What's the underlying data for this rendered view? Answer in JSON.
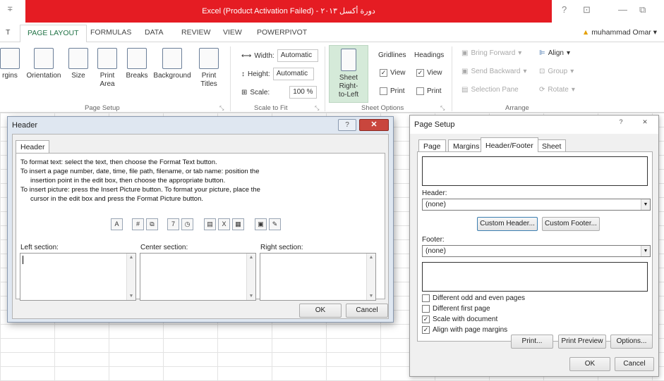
{
  "window": {
    "title": "Excel (Product Activation Failed) - دورة أكسل ٢٠١٣",
    "quick_access": "∓",
    "controls": [
      "?",
      "⊡",
      "—",
      "⧉"
    ]
  },
  "tabs": [
    {
      "label": "T"
    },
    {
      "label": "PAGE LAYOUT",
      "active": true
    },
    {
      "label": "FORMULAS"
    },
    {
      "label": "DATA"
    },
    {
      "label": "REVIEW"
    },
    {
      "label": "VIEW"
    },
    {
      "label": "POWERPIVOT"
    }
  ],
  "user": {
    "name": "muhammad Omar",
    "chevron": "▾"
  },
  "ribbon": {
    "page_setup": {
      "margins": "rgins",
      "orientation": "Orientation",
      "size": "Size",
      "print_area": "Print",
      "print_area_2": "Area",
      "breaks": "Breaks",
      "background": "Background",
      "print_titles": "Print",
      "print_titles_2": "Titles",
      "group": "Page Setup"
    },
    "scale_to_fit": {
      "width_label": "Width:",
      "width_value": "Automatic",
      "height_label": "Height:",
      "height_value": "Automatic",
      "scale_label": "Scale:",
      "scale_value": "100 %",
      "group": "Scale to Fit"
    },
    "sheet_options": {
      "sheet_rtl": "Sheet Right-",
      "sheet_rtl_2": "to-Left",
      "gridlines": "Gridlines",
      "headings": "Headings",
      "view": "View",
      "print": "Print",
      "group": "Sheet Options"
    },
    "arrange": {
      "bring_forward": "Bring Forward",
      "send_backward": "Send Backward",
      "selection_pane": "Selection Pane",
      "align": "Align",
      "group_btn": "Group",
      "rotate": "Rotate",
      "group": "Arrange"
    },
    "dialog_launcher": "⤡"
  },
  "header_dialog": {
    "title": "Header",
    "help": "?",
    "close": "✕",
    "tab": "Header",
    "instructions": [
      "To format text:  select the text, then choose the Format Text button.",
      "To insert a page number, date, time, file path, filename, or tab name:  position the",
      "insertion point in the edit box, then choose the appropriate button.",
      "To insert picture: press the Insert Picture button.  To format your picture, place the",
      "cursor in the edit box and press the Format Picture button."
    ],
    "toolbar": [
      "A",
      "#",
      "⧉",
      "7",
      "◷",
      "▤",
      "X",
      "▦",
      "▣",
      "✎"
    ],
    "left_section": "Left section:",
    "center_section": "Center section:",
    "right_section": "Right section:",
    "ok": "OK",
    "cancel": "Cancel"
  },
  "page_setup": {
    "title": "Page Setup",
    "help": "?",
    "close": "✕",
    "tabs": [
      "Page",
      "Margins",
      "Header/Footer",
      "Sheet"
    ],
    "active_tab": "Header/Footer",
    "header_label": "Header:",
    "header_value": "(none)",
    "custom_header": "Custom Header...",
    "custom_footer": "Custom Footer...",
    "footer_label": "Footer:",
    "footer_value": "(none)",
    "checks": [
      {
        "label": "Different odd and even pages",
        "checked": false
      },
      {
        "label": "Different first page",
        "checked": false
      },
      {
        "label": "Scale with document",
        "checked": true
      },
      {
        "label": "Align with page margins",
        "checked": true
      }
    ],
    "print": "Print...",
    "print_preview": "Print Preview",
    "options": "Options...",
    "ok": "OK",
    "cancel": "Cancel"
  }
}
